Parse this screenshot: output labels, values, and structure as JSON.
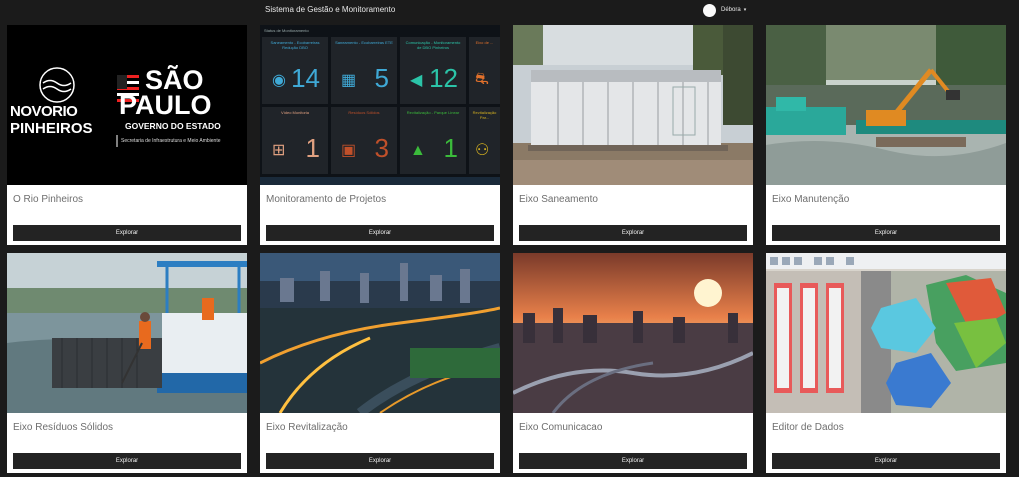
{
  "header": {
    "title": "Sistema de Gestão e Monitoramento",
    "user_name": "Débora"
  },
  "explore_label": "Explorar",
  "cards": [
    {
      "title": "O Rio Pinheiros"
    },
    {
      "title": "Monitoramento de Projetos"
    },
    {
      "title": "Eixo Saneamento"
    },
    {
      "title": "Eixo Manutenção"
    },
    {
      "title": "Eixo Resíduos Sólidos"
    },
    {
      "title": "Eixo Revitalização"
    },
    {
      "title": "Eixo Comunicacao"
    },
    {
      "title": "Editor de Dados"
    }
  ],
  "logo": {
    "novo": "NOVORIO",
    "pinheiros": "PINHEIROS",
    "sao": "SÃO",
    "paulo": "PAULO",
    "governo": "GOVERNO DO ESTADO",
    "secretaria": "Secretaria de Infraestrutura e Meio Ambiente"
  },
  "dashboard": {
    "header": "Status de Monitoramento",
    "tiles": [
      {
        "label": "Saneamento - Ecobarreiras Redução DBO",
        "value": "14",
        "color": "#3fa9d6"
      },
      {
        "label": "Saneamento - Ecobarreiras ETE",
        "value": "5",
        "color": "#3fa9d6"
      },
      {
        "label": "Comunicação - Monitoramento de DBO Pinheiros",
        "value": "12",
        "color": "#2bc4a8"
      },
      {
        "label": "Eixo de ...",
        "value": "",
        "color": "#e0702b"
      },
      {
        "label": "Vídeo Monitoria",
        "value": "1",
        "color": "#e0a080"
      },
      {
        "label": "Resíduos Sólidos",
        "value": "3",
        "color": "#c0502a"
      },
      {
        "label": "Revitalização - Parque Linear",
        "value": "1",
        "color": "#3bbb3b"
      },
      {
        "label": "Revitalização Par...",
        "value": "",
        "color": "#d4b020"
      }
    ]
  }
}
